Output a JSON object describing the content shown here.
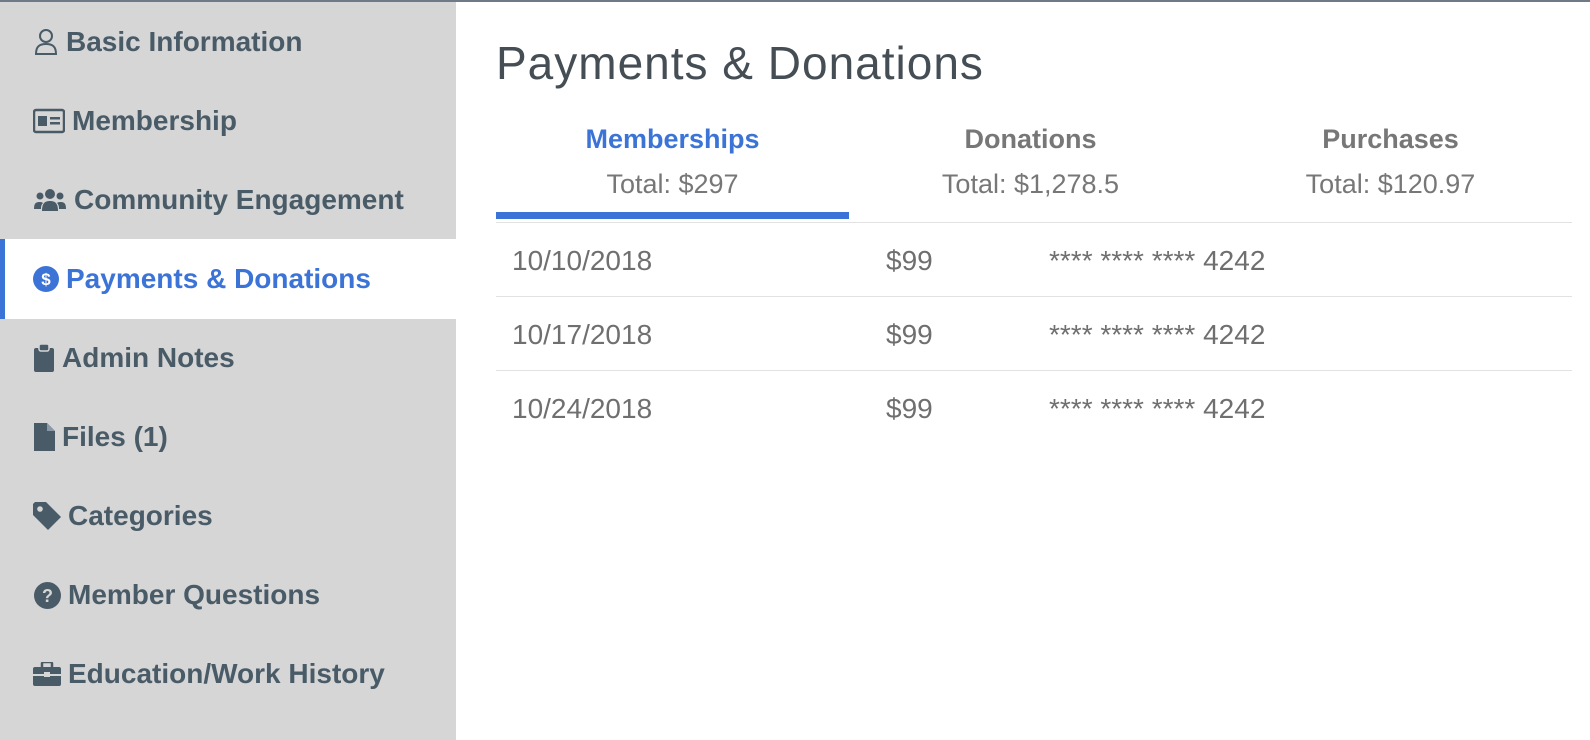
{
  "sidebar": {
    "items": [
      {
        "label": "Basic Information",
        "icon": "user-icon"
      },
      {
        "label": "Membership",
        "icon": "id-card-icon"
      },
      {
        "label": "Community Engagement",
        "icon": "users-icon"
      },
      {
        "label": "Payments & Donations",
        "icon": "dollar-circle-icon",
        "active": true
      },
      {
        "label": "Admin Notes",
        "icon": "clipboard-icon"
      },
      {
        "label": "Files (1)",
        "icon": "file-icon"
      },
      {
        "label": "Categories",
        "icon": "tag-icon"
      },
      {
        "label": "Member Questions",
        "icon": "question-circle-icon"
      },
      {
        "label": "Education/Work History",
        "icon": "briefcase-icon"
      }
    ]
  },
  "main": {
    "title": "Payments & Donations",
    "tabs": [
      {
        "label": "Memberships",
        "total": "Total: $297",
        "active": true
      },
      {
        "label": "Donations",
        "total": "Total: $1,278.5"
      },
      {
        "label": "Purchases",
        "total": "Total: $120.97"
      }
    ],
    "rows": [
      {
        "date": "10/10/2018",
        "amount": "$99",
        "card": "**** **** **** 4242"
      },
      {
        "date": "10/17/2018",
        "amount": "$99",
        "card": "**** **** **** 4242"
      },
      {
        "date": "10/24/2018",
        "amount": "$99",
        "card": "**** **** **** 4242"
      }
    ]
  },
  "colors": {
    "accent": "#3b74d6",
    "sidebar_bg": "#d6d6d6",
    "sidebar_text": "#4a5b68",
    "muted_text": "#777777"
  }
}
